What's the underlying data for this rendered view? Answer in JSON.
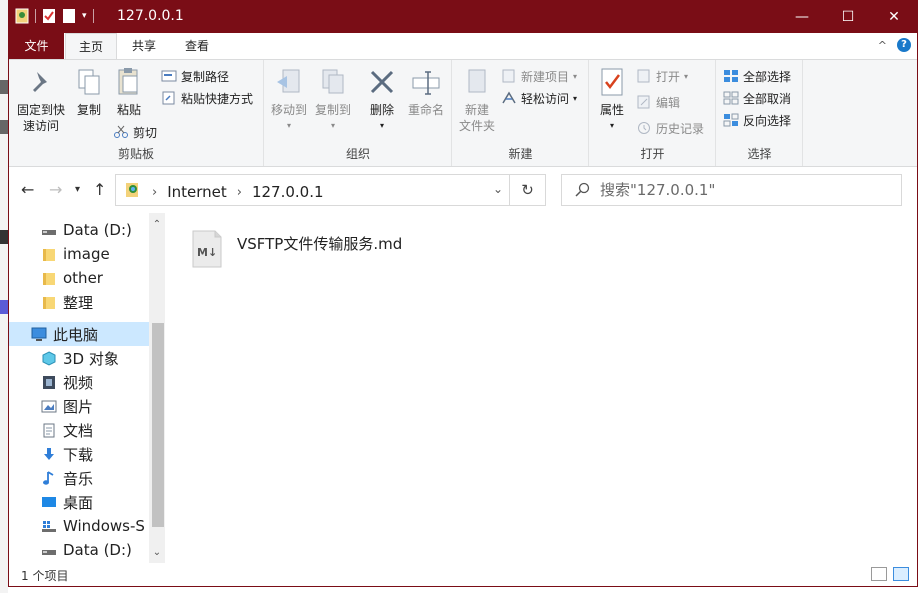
{
  "window": {
    "title": "127.0.0.1",
    "accent_color": "#7a0d16"
  },
  "controls": {
    "minimize": "—",
    "maximize": "☐",
    "close": "✕",
    "ribbon_collapse": "^",
    "help": "?"
  },
  "tabs": {
    "file": "文件",
    "home": "主页",
    "share": "共享",
    "view": "查看"
  },
  "ribbon": {
    "clipboard": {
      "label": "剪贴板",
      "pin_line1": "固定到快",
      "pin_line2": "速访问",
      "copy": "复制",
      "paste": "粘贴",
      "copy_path": "复制路径",
      "paste_shortcut": "粘贴快捷方式",
      "cut": "剪切"
    },
    "organize": {
      "label": "组织",
      "move_to": "移动到",
      "copy_to": "复制到",
      "delete": "删除",
      "rename": "重命名"
    },
    "new": {
      "label": "新建",
      "new_folder_line1": "新建",
      "new_folder_line2": "文件夹",
      "new_item": "新建项目",
      "easy_access": "轻松访问"
    },
    "open": {
      "label": "打开",
      "properties": "属性",
      "open": "打开",
      "edit": "编辑",
      "history": "历史记录"
    },
    "select": {
      "label": "选择",
      "select_all": "全部选择",
      "select_none": "全部取消",
      "invert": "反向选择"
    }
  },
  "address": {
    "crumbs": [
      "Internet",
      "127.0.0.1"
    ],
    "search_placeholder": "搜索\"127.0.0.1\""
  },
  "nav": {
    "items": [
      {
        "label": "Data (D:)",
        "icon": "drive-icon"
      },
      {
        "label": "image",
        "icon": "folder-icon"
      },
      {
        "label": "other",
        "icon": "folder-icon"
      },
      {
        "label": "整理",
        "icon": "folder-icon"
      },
      {
        "label": "此电脑",
        "icon": "computer-icon",
        "selected": true
      },
      {
        "label": "3D 对象",
        "icon": "3d-objects-icon"
      },
      {
        "label": "视频",
        "icon": "video-icon"
      },
      {
        "label": "图片",
        "icon": "pictures-icon"
      },
      {
        "label": "文档",
        "icon": "documents-icon"
      },
      {
        "label": "下载",
        "icon": "download-icon"
      },
      {
        "label": "音乐",
        "icon": "music-icon"
      },
      {
        "label": "桌面",
        "icon": "desktop-icon"
      },
      {
        "label": "Windows-S",
        "icon": "windows-drive-icon"
      },
      {
        "label": "Data (D:)",
        "icon": "drive-icon"
      }
    ]
  },
  "files": [
    {
      "name": "VSFTP文件传输服务.md",
      "icon": "markdown-file-icon"
    }
  ],
  "status": {
    "item_count": "1 个项目"
  }
}
